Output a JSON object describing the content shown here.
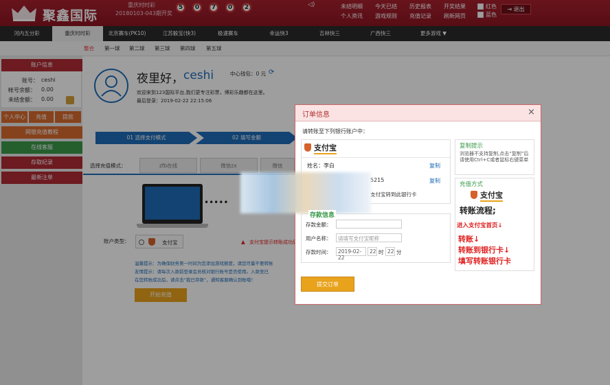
{
  "header": {
    "logo_text": "聚鑫国际",
    "lottery_name": "重庆时时彩",
    "issue": "20180103-043期开奖",
    "balls": [
      "5",
      "0",
      "7",
      "0",
      "2"
    ],
    "links_row1": [
      "未结明细",
      "今天已结",
      "历史报表",
      "开奖结果"
    ],
    "links_row2": [
      "个人资讯",
      "游戏规则",
      "充值记录",
      "刷新网页"
    ],
    "color_red": "红色",
    "color_blue": "蓝色",
    "logout": "退出"
  },
  "nav": [
    "河内五分彩",
    "重庆时时彩",
    "北京赛车(PK10)",
    "江苏骰宝(快3)",
    "极速赛车",
    "幸运快3",
    "吉林快三",
    "广西快三",
    "更多游戏 ▼"
  ],
  "subnav": [
    "整合",
    "第一球",
    "第二球",
    "第三球",
    "第四球",
    "第五球"
  ],
  "sidebar": {
    "account_info": "账户信息",
    "account_label": "账号：",
    "account_value": "ceshi",
    "balance_label": "帐号余额：",
    "balance_value": "0.00",
    "unsettled_label": "未结金额：",
    "unsettled_value": "0.00",
    "btn_user": "个人中心",
    "btn_recharge": "充值",
    "btn_withdraw": "提款",
    "items": [
      "网银充值教程",
      "在线客服",
      "存取纪录",
      "最新注单"
    ]
  },
  "main": {
    "greet": "夜里好，",
    "user": "ceshi",
    "wallet": "中心钱包：0 元",
    "welcome": "欢迎来到123国际平台,我们更专注彩票，博彩乐趣都在这里。",
    "last_login": "最后登录：2019-02-22 22:15:06",
    "steps": [
      "01 选择支付模式",
      "02 填写金额"
    ],
    "pay_mode_label": "选择充值模式：",
    "pay_tabs": [
      "zfb在线",
      "微信zx",
      "微信"
    ],
    "account_type_label": "账户类型：",
    "alipay": "支付宝",
    "warn": "支付宝提示转账成功后",
    "tip1": "温馨提示：为确保财务第一时间为您添加游戏额度，请您尽量不要转账",
    "tip2": "友情提示：请每次入款前登录会员核对银行账号是否使用。入款至已",
    "tip3": "在您转账成功后，请点击“我已存款”，通知客服确认到账哦！",
    "start_btn": "开始充值"
  },
  "modal": {
    "title": "订单信息",
    "close": "×",
    "intro": "请转账至下列银行账户中：",
    "brand": "支付宝",
    "name_label": "姓名：李白",
    "copy": "复制",
    "account_suffix": "5215",
    "transfer_note": "支付宝转到此银行卡",
    "deposit_title": "存款信息",
    "amount_label": "存款金额：",
    "username_label": "用户名称：",
    "username_placeholder": "请填写支付宝昵称",
    "time_label": "存款时间：",
    "date": "2019-02-22",
    "hour": "22",
    "hour_unit": "时",
    "minute": "22",
    "minute_unit": "分",
    "submit": "提交订单",
    "copy_tip_title": "复制提示",
    "copy_tip_text": "浏览器不支持复制,点击“复制”后请使用Ctrl+C或者鼠标右键菜单",
    "method_title": "充值方式",
    "flow_title": "转账流程;",
    "flow_step1": "进入支付宝首页↓",
    "flow_big": [
      "转账↓",
      "转账到银行卡↓",
      "填写转账银行卡"
    ]
  }
}
